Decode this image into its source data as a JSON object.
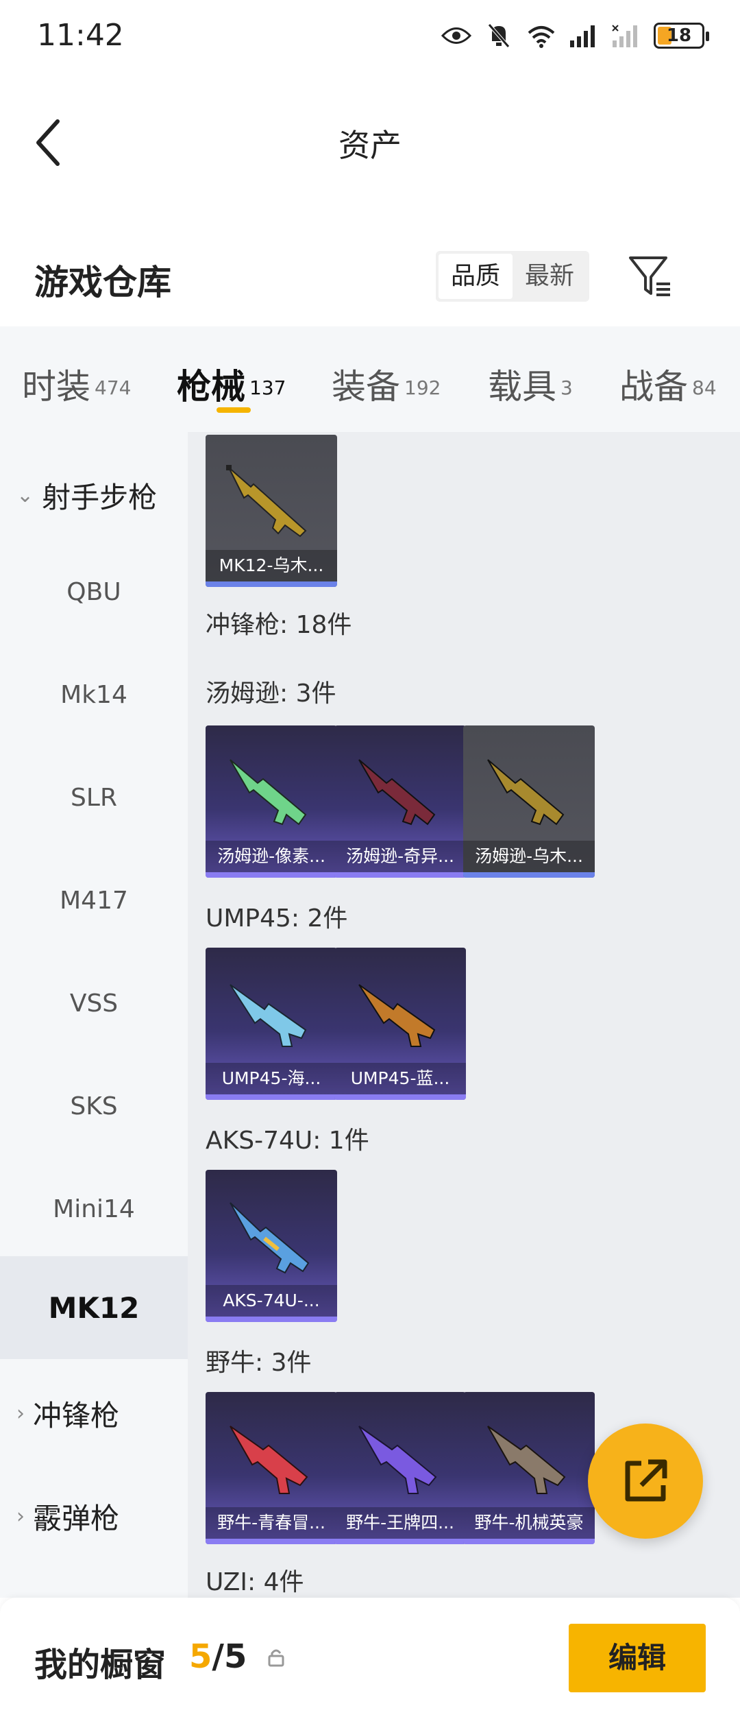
{
  "status_bar": {
    "time": "11:42",
    "battery": "18"
  },
  "header": {
    "title": "资产"
  },
  "warehouse": {
    "title": "游戏仓库",
    "sort_options": [
      "品质",
      "最新"
    ],
    "sort_selected": "品质"
  },
  "category_tabs": [
    {
      "label": "时装",
      "count": "474"
    },
    {
      "label": "枪械",
      "count": "137",
      "active": true
    },
    {
      "label": "装备",
      "count": "192"
    },
    {
      "label": "载具",
      "count": "3"
    },
    {
      "label": "战备",
      "count": "84"
    }
  ],
  "sidebar": {
    "group_expanded": "射手步枪",
    "items": [
      "QBU",
      "Mk14",
      "SLR",
      "M417",
      "VSS",
      "SKS",
      "Mini14",
      "MK12"
    ],
    "selected": "MK12",
    "groups_collapsed": [
      "冲锋枪",
      "霰弹枪"
    ]
  },
  "content": {
    "top_card": {
      "name": "MK12-乌木..."
    },
    "summary": "冲锋枪: 18件",
    "sections": [
      {
        "title": "汤姆逊: 3件",
        "cards": [
          "汤姆逊-像素...",
          "汤姆逊-奇异...",
          "汤姆逊-乌木..."
        ]
      },
      {
        "title": "UMP45: 2件",
        "cards": [
          "UMP45-海...",
          "UMP45-蓝..."
        ]
      },
      {
        "title": "AKS-74U: 1件",
        "cards": [
          "AKS-74U-..."
        ]
      },
      {
        "title": "野牛: 3件",
        "cards": [
          "野牛-青春冒...",
          "野牛-王牌四...",
          "野牛-机械英豪"
        ]
      },
      {
        "title": "UZI: 4件"
      }
    ]
  },
  "bottom_bar": {
    "showcase_label": "我的橱窗",
    "showcase_current": "5",
    "showcase_total": "/5",
    "edit_label": "编辑"
  },
  "colors": {
    "accent": "#f7b400",
    "card_purple": "#3a3570",
    "card_gray": "#4a4b52"
  }
}
